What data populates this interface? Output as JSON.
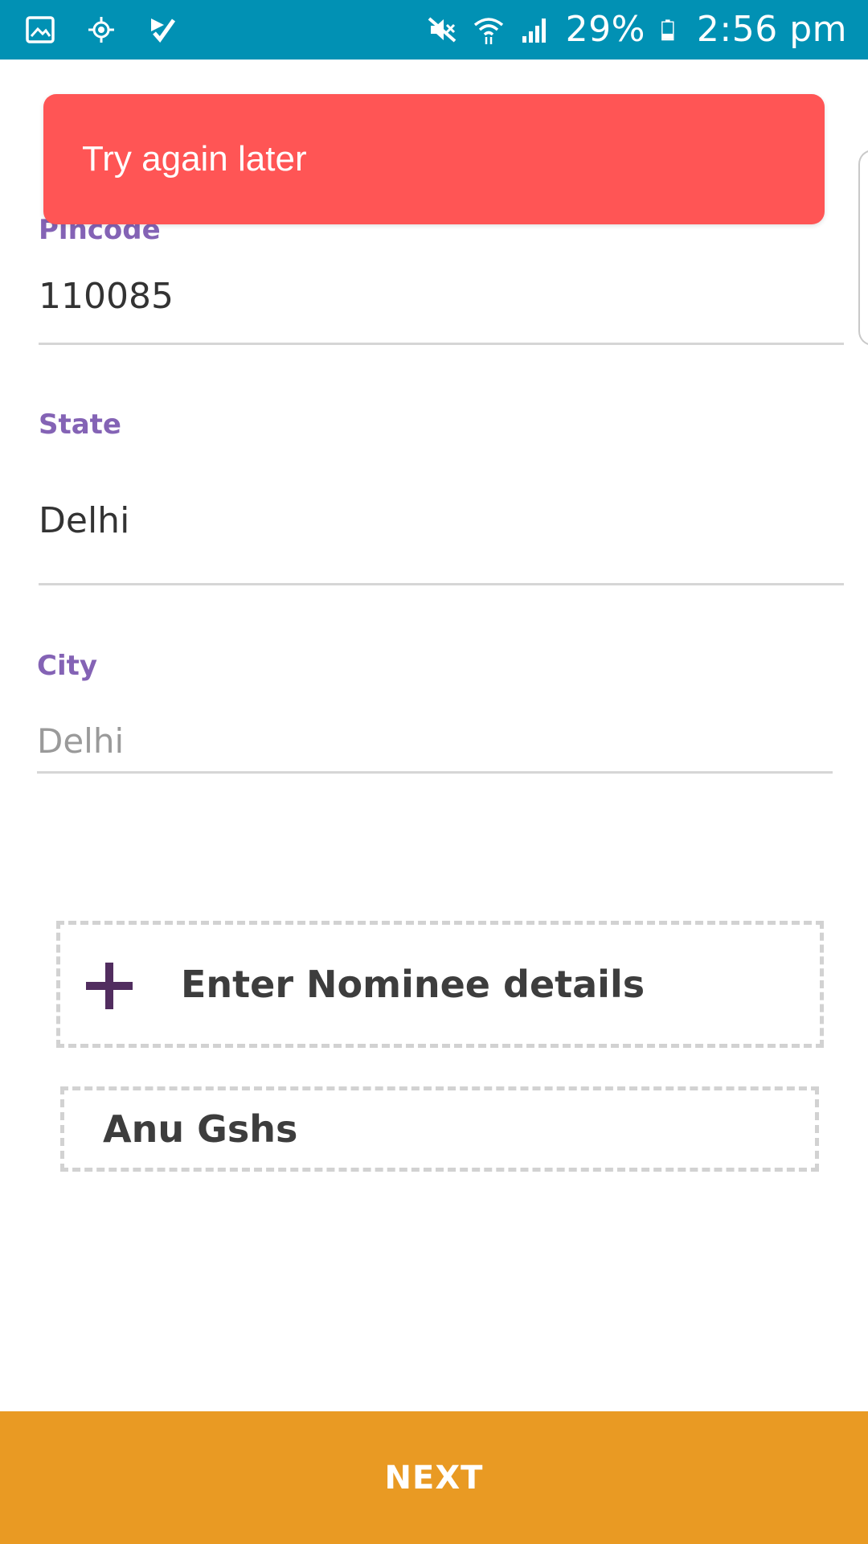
{
  "status_bar": {
    "battery": "29%",
    "time": "2:56 pm",
    "icons": [
      "gallery-icon",
      "location-icon",
      "checkmark-app-icon",
      "mute-icon",
      "wifi-icon",
      "signal-icon",
      "battery-icon"
    ]
  },
  "toast": {
    "message": "Try again later",
    "color": "#ff5555"
  },
  "form": {
    "pincode": {
      "label": "Pincode",
      "value": "110085"
    },
    "state": {
      "label": "State",
      "value": "Delhi"
    },
    "city": {
      "label": "City",
      "placeholder": "Delhi"
    }
  },
  "nominee": {
    "add_label": "Enter Nominee details",
    "entries": [
      "Anu Gshs"
    ]
  },
  "footer": {
    "next_label": "NEXT",
    "color": "#e99a23"
  },
  "colors": {
    "status_bar": "#0191b4",
    "label_purple": "#8463b5",
    "plus_icon": "#512d5f"
  }
}
